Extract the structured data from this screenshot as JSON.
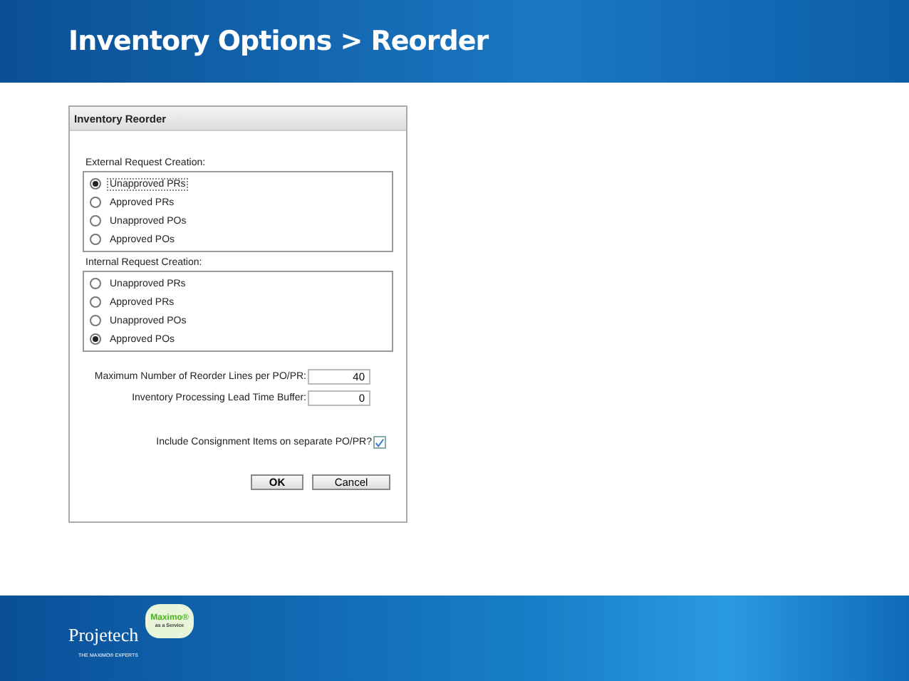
{
  "slide_title": "Inventory Options > Reorder",
  "dialog": {
    "title": "Inventory Reorder",
    "groups": [
      {
        "label": "External Request Creation:",
        "options": [
          {
            "label": "Unapproved PRs",
            "selected": true,
            "focused": true
          },
          {
            "label": "Approved PRs",
            "selected": false,
            "focused": false
          },
          {
            "label": "Unapproved POs",
            "selected": false,
            "focused": false
          },
          {
            "label": "Approved POs",
            "selected": false,
            "focused": false
          }
        ]
      },
      {
        "label": "Internal Request Creation:",
        "options": [
          {
            "label": "Unapproved PRs",
            "selected": false,
            "focused": false
          },
          {
            "label": "Approved PRs",
            "selected": false,
            "focused": false
          },
          {
            "label": "Unapproved POs",
            "selected": false,
            "focused": false
          },
          {
            "label": "Approved POs",
            "selected": true,
            "focused": false
          }
        ]
      }
    ],
    "fields": [
      {
        "label": "Maximum Number of Reorder Lines per PO/PR:",
        "value": "40"
      },
      {
        "label": "Inventory Processing Lead Time Buffer:",
        "value": "0"
      }
    ],
    "checkbox": {
      "label": "Include Consignment Items on separate PO/PR?",
      "checked": true
    },
    "buttons": [
      "OK",
      "Cancel"
    ]
  },
  "footer": {
    "logo": "Projetech",
    "tagline": "THE MAXIMO® EXPERTS",
    "badge_title": "Maximo®",
    "badge_subtitle": "as a Service"
  }
}
